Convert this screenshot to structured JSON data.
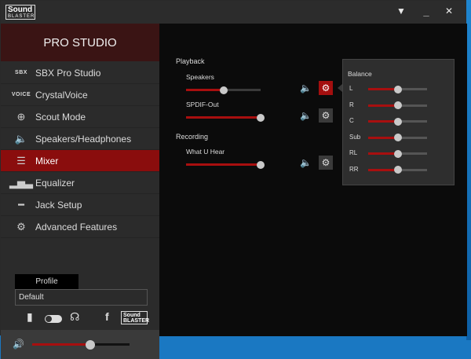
{
  "titlebar": {
    "logo_line1": "Sound",
    "logo_line2": "BLASTER",
    "menu_glyph": "▼",
    "close_glyph": "✕"
  },
  "sidebar": {
    "brand": "PRO STUDIO",
    "items": [
      {
        "label": "SBX Pro Studio",
        "icon": "sbx-icon",
        "icon_text": "SBX",
        "active": false
      },
      {
        "label": "CrystalVoice",
        "icon": "crystalvoice-icon",
        "icon_text": "VOICE",
        "active": false
      },
      {
        "label": "Scout Mode",
        "icon": "crosshair-icon",
        "icon_text": "⊕",
        "active": false
      },
      {
        "label": "Speakers/Headphones",
        "icon": "speaker-headphone-icon",
        "icon_text": "🔈",
        "active": false
      },
      {
        "label": "Mixer",
        "icon": "mixer-icon",
        "icon_text": "☰",
        "active": true
      },
      {
        "label": "Equalizer",
        "icon": "equalizer-icon",
        "icon_text": "▂▅▃",
        "active": false
      },
      {
        "label": "Jack Setup",
        "icon": "jack-icon",
        "icon_text": "━",
        "active": false
      },
      {
        "label": "Advanced Features",
        "icon": "gears-icon",
        "icon_text": "⚙",
        "active": false
      }
    ],
    "profile": {
      "tab_label": "Profile",
      "value": "Default"
    },
    "footer": {
      "mini_logo_line1": "Sound",
      "mini_logo_line2": "BLASTER",
      "facebook_glyph": "f"
    },
    "output_toggle_on": false,
    "master_volume": 0.6
  },
  "mixer": {
    "playback_title": "Playback",
    "recording_title": "Recording",
    "channels": [
      {
        "label": "Speakers",
        "level": 0.5,
        "settings_active": true
      },
      {
        "label": "SPDIF-Out",
        "level": 1.0,
        "settings_active": false
      },
      {
        "label": "What U Hear",
        "level": 1.0,
        "settings_active": false
      }
    ]
  },
  "balance": {
    "title": "Balance",
    "rows": [
      {
        "label": "L",
        "level": 0.5
      },
      {
        "label": "R",
        "level": 0.5
      },
      {
        "label": "C",
        "level": 0.5
      },
      {
        "label": "Sub",
        "level": 0.5
      },
      {
        "label": "RL",
        "level": 0.5
      },
      {
        "label": "RR",
        "level": 0.5
      }
    ]
  },
  "colors": {
    "accent": "#a80f0f",
    "active_nav": "#8a0d0d",
    "brand_bg": "#3a1414"
  }
}
